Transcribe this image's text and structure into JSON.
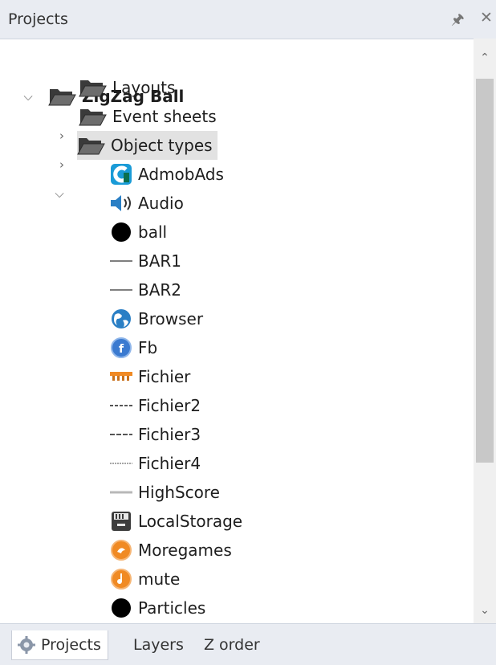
{
  "panel": {
    "title": "Projects",
    "pin_icon": "pin-icon",
    "close_icon": "close-icon"
  },
  "tree": {
    "root": "ZigZag Ball",
    "folders": [
      {
        "label": "Layouts",
        "expanded": false
      },
      {
        "label": "Event sheets",
        "expanded": false
      },
      {
        "label": "Object types",
        "expanded": true,
        "selected": true
      }
    ],
    "objects": [
      {
        "label": "AdmobAds",
        "icon": "admob-icon"
      },
      {
        "label": "Audio",
        "icon": "speaker-icon"
      },
      {
        "label": "ball",
        "icon": "black-circle-icon"
      },
      {
        "label": "BAR1",
        "icon": "thin-line-icon"
      },
      {
        "label": "BAR2",
        "icon": "thin-line-icon"
      },
      {
        "label": "Browser",
        "icon": "globe-icon"
      },
      {
        "label": "Fb",
        "icon": "facebook-icon"
      },
      {
        "label": "Fichier",
        "icon": "sprite-thumbnail-icon"
      },
      {
        "label": "Fichier2",
        "icon": "dashed-line-icon"
      },
      {
        "label": "Fichier3",
        "icon": "dashed-line-icon"
      },
      {
        "label": "Fichier4",
        "icon": "dotted-line-icon"
      },
      {
        "label": "HighScore",
        "icon": "gray-line-icon"
      },
      {
        "label": "LocalStorage",
        "icon": "disk-icon"
      },
      {
        "label": "Moregames",
        "icon": "orange-button-icon"
      },
      {
        "label": "mute",
        "icon": "orange-button-icon"
      },
      {
        "label": "Particles",
        "icon": "black-circle-icon"
      }
    ]
  },
  "tabs": [
    {
      "label": "Projects",
      "active": true,
      "icon": "projects-gear-icon"
    },
    {
      "label": "Layers",
      "active": false
    },
    {
      "label": "Z order",
      "active": false
    }
  ],
  "colors": {
    "orange": "#f08a24",
    "blue": "#2a7fc5"
  }
}
